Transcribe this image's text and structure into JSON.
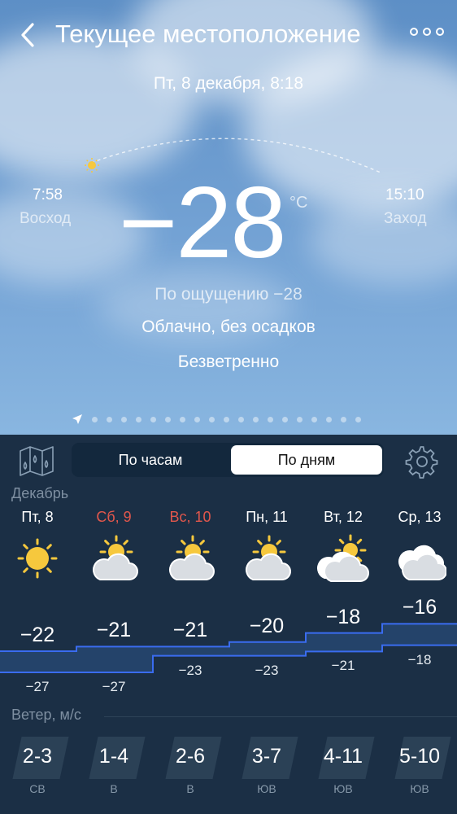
{
  "header": {
    "title": "Текущее местоположение",
    "datetime": "Пт, 8 декабря, 8:18"
  },
  "sun": {
    "sunrise_time": "7:58",
    "sunrise_label": "Восход",
    "sunset_time": "15:10",
    "sunset_label": "Заход"
  },
  "current": {
    "temperature": "−28",
    "unit": "°C",
    "feels_like": "По ощущению −28",
    "condition": "Облачно, без осадков",
    "wind": "Безветренно"
  },
  "tabs": {
    "hourly": "По часам",
    "daily": "По дням",
    "active": "daily"
  },
  "month": "Декабрь",
  "days": [
    {
      "name": "Пт, 8",
      "weekend": false,
      "icon": "sun-icon",
      "max": "−22",
      "min": "−27",
      "wind": "2-3",
      "wind_dir": "СВ"
    },
    {
      "name": "Сб, 9",
      "weekend": true,
      "icon": "partly-cloudy-icon",
      "max": "−21",
      "min": "−27",
      "wind": "1-4",
      "wind_dir": "В"
    },
    {
      "name": "Вс, 10",
      "weekend": true,
      "icon": "partly-cloudy-icon",
      "max": "−21",
      "min": "−23",
      "wind": "2-6",
      "wind_dir": "В"
    },
    {
      "name": "Пн, 11",
      "weekend": false,
      "icon": "partly-cloudy-icon",
      "max": "−20",
      "min": "−23",
      "wind": "3-7",
      "wind_dir": "ЮВ"
    },
    {
      "name": "Вт, 12",
      "weekend": false,
      "icon": "cloudy-with-sun-icon",
      "max": "−18",
      "min": "−21",
      "wind": "4-11",
      "wind_dir": "ЮВ"
    },
    {
      "name": "Ср, 13",
      "weekend": false,
      "icon": "overcast-icon",
      "max": "−16",
      "min": "−18",
      "wind": "5-10",
      "wind_dir": "ЮВ"
    }
  ],
  "wind_header": "Ветер, м/с",
  "colors": {
    "panel": "#1b2f45",
    "weekend": "#e2574c",
    "temp_line": "#3a6cf0",
    "sun": "#f6c83d"
  }
}
